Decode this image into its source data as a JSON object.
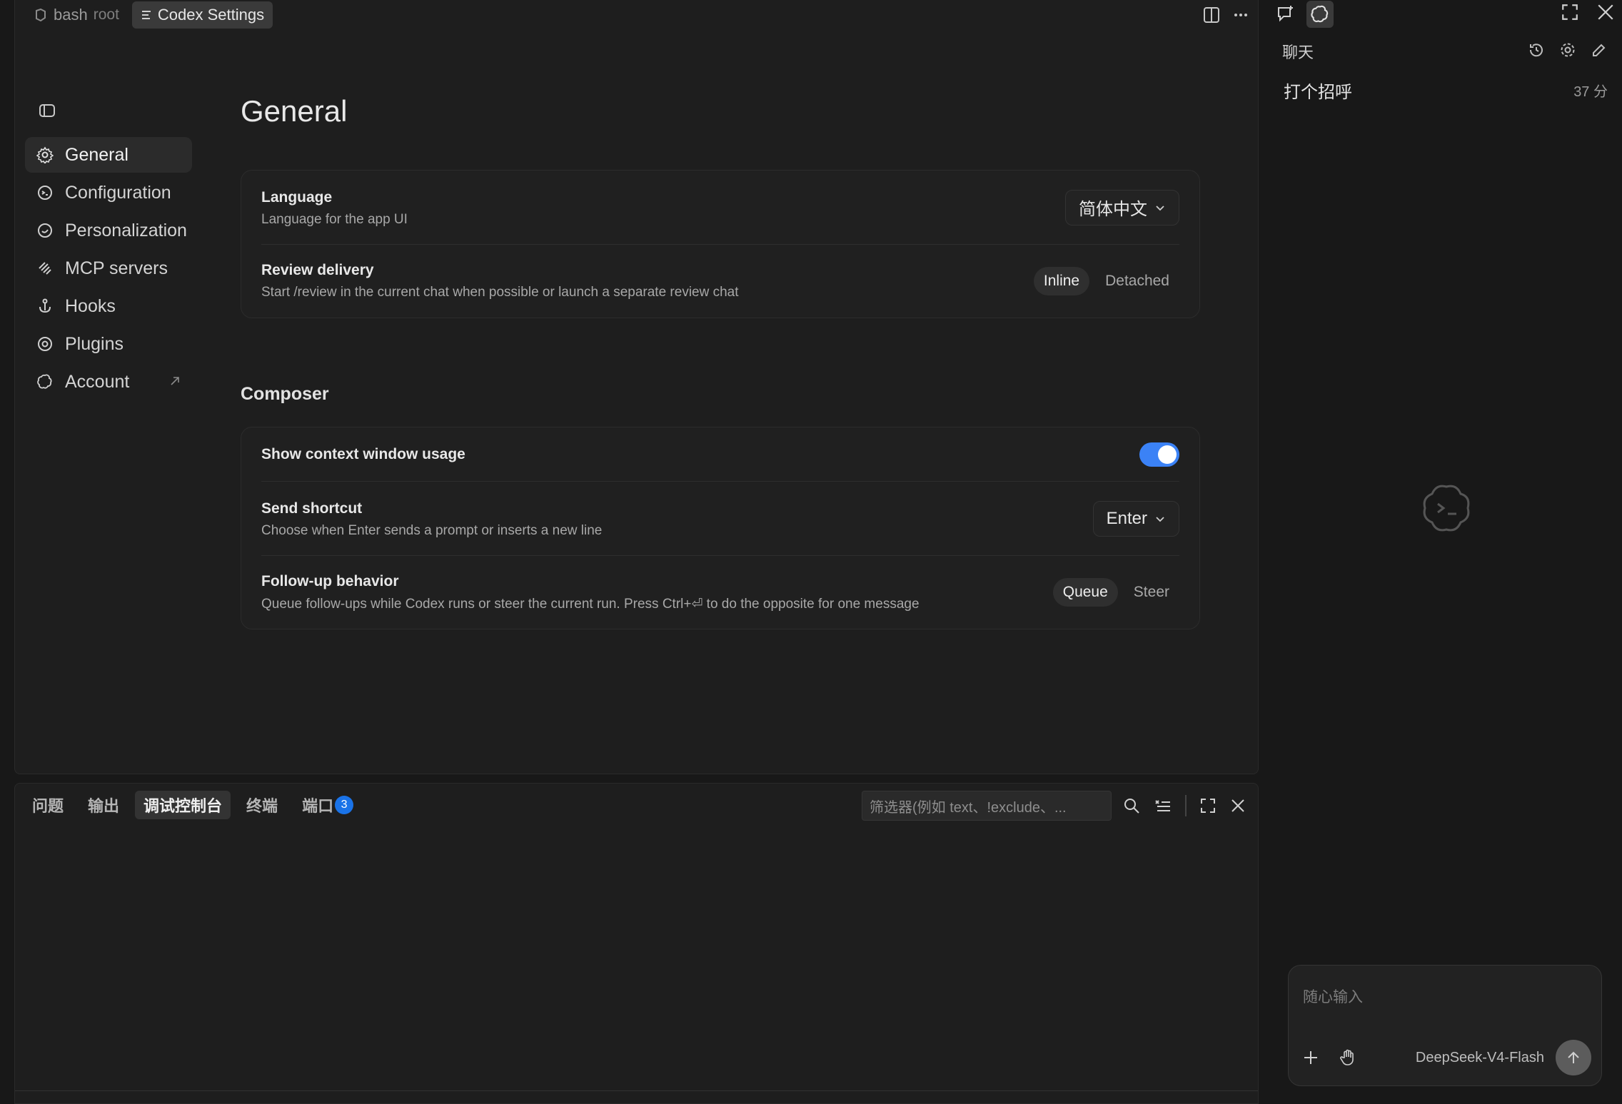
{
  "tabs": [
    {
      "label": "bash",
      "sub": "root"
    },
    {
      "label": "Codex Settings"
    }
  ],
  "nav": {
    "items": [
      {
        "label": "General",
        "icon": "gear-icon"
      },
      {
        "label": "Configuration",
        "icon": "config-icon"
      },
      {
        "label": "Personalization",
        "icon": "personalization-icon"
      },
      {
        "label": "MCP servers",
        "icon": "mcp-icon"
      },
      {
        "label": "Hooks",
        "icon": "hook-icon"
      },
      {
        "label": "Plugins",
        "icon": "plugin-icon"
      },
      {
        "label": "Account",
        "icon": "openai-icon"
      }
    ]
  },
  "general": {
    "title": "General",
    "language": {
      "title": "Language",
      "desc": "Language for the app UI",
      "value": "简体中文"
    },
    "review": {
      "title": "Review delivery",
      "desc": "Start /review in the current chat when possible or launch a separate review chat",
      "options": [
        "Inline",
        "Detached"
      ],
      "selected": "Inline"
    }
  },
  "composer": {
    "title": "Composer",
    "context": {
      "title": "Show context window usage",
      "enabled": true
    },
    "send": {
      "title": "Send shortcut",
      "desc": "Choose when Enter sends a prompt or inserts a new line",
      "value": "Enter"
    },
    "followup": {
      "title": "Follow-up behavior",
      "desc": "Queue follow-ups while Codex runs or steer the current run. Press Ctrl+⏎ to do the opposite for one message",
      "options": [
        "Queue",
        "Steer"
      ],
      "selected": "Queue"
    }
  },
  "panel": {
    "tabs": [
      "问题",
      "输出",
      "调试控制台",
      "终端",
      "端口"
    ],
    "active": "调试控制台",
    "ports_badge": "3",
    "filter_placeholder": "筛选器(例如 text、!exclude、..."
  },
  "chat": {
    "header": "聊天",
    "conversation": {
      "title": "打个招呼",
      "time": "37 分"
    },
    "input_placeholder": "随心输入",
    "model": "DeepSeek-V4-Flash"
  },
  "colors": {
    "accent": "#3b82f6",
    "badge": "#1a73e8"
  }
}
